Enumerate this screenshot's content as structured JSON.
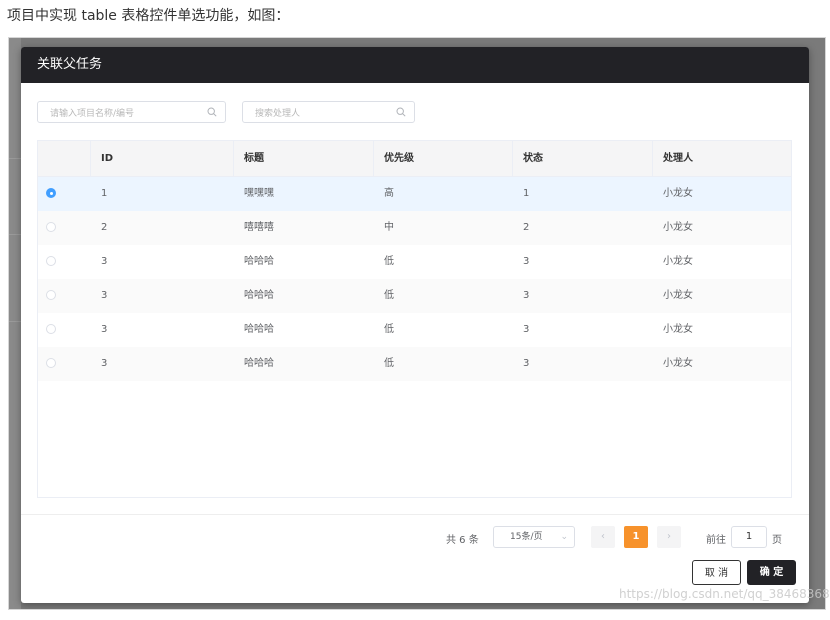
{
  "article": {
    "intro": "项目中实现 table 表格控件单选功能，如图："
  },
  "modal": {
    "title": "关联父任务"
  },
  "search": {
    "project_placeholder": "请输入项目名称/编号",
    "handler_placeholder": "搜索处理人"
  },
  "table": {
    "columns": [
      "",
      "ID",
      "标题",
      "优先级",
      "状态",
      "处理人"
    ],
    "rows": [
      {
        "selected": true,
        "id": "1",
        "title": "嘿嘿嘿",
        "priority": "高",
        "status": "1",
        "handler": "小龙女"
      },
      {
        "selected": false,
        "id": "2",
        "title": "嘻嘻嘻",
        "priority": "中",
        "status": "2",
        "handler": "小龙女"
      },
      {
        "selected": false,
        "id": "3",
        "title": "哈哈哈",
        "priority": "低",
        "status": "3",
        "handler": "小龙女"
      },
      {
        "selected": false,
        "id": "3",
        "title": "哈哈哈",
        "priority": "低",
        "status": "3",
        "handler": "小龙女"
      },
      {
        "selected": false,
        "id": "3",
        "title": "哈哈哈",
        "priority": "低",
        "status": "3",
        "handler": "小龙女"
      },
      {
        "selected": false,
        "id": "3",
        "title": "哈哈哈",
        "priority": "低",
        "status": "3",
        "handler": "小龙女"
      }
    ]
  },
  "pagination": {
    "total_text": "共 6 条",
    "page_size": "15条/页",
    "prev_icon": "chevron-left-icon",
    "current_page": "1",
    "next_icon": "chevron-right-icon",
    "goto_label": "前往",
    "goto_value": "1",
    "goto_suffix": "页"
  },
  "footer": {
    "cancel_label": "取 消",
    "ok_label": "确 定"
  },
  "watermark": "https://blog.csdn.net/qq_38468368",
  "colors": {
    "header_bg": "#222226",
    "accent_blue": "#409eff",
    "pager_active": "#f7922b",
    "selected_row_bg": "#ecf5ff"
  }
}
